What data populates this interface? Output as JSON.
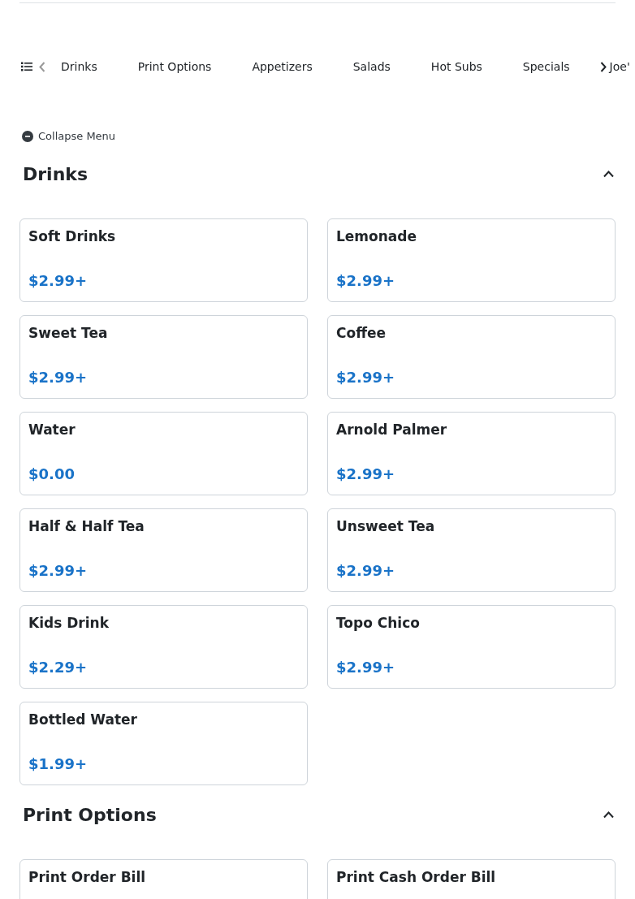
{
  "nav": {
    "tabs": [
      {
        "label": "Drinks",
        "selected": false
      },
      {
        "label": "Print Options",
        "selected": false
      },
      {
        "label": "Appetizers",
        "selected": false
      },
      {
        "label": "Salads",
        "selected": false
      },
      {
        "label": "Hot Subs",
        "selected": false
      },
      {
        "label": "Specials",
        "selected": false
      },
      {
        "label": "Joe'",
        "selected": false
      }
    ]
  },
  "collapse_menu": "Collapse Menu",
  "sections": [
    {
      "title": "Drinks",
      "expanded": true,
      "items": [
        {
          "name": "Soft Drinks",
          "price": "$2.99+"
        },
        {
          "name": "Lemonade",
          "price": "$2.99+"
        },
        {
          "name": "Sweet Tea",
          "price": "$2.99+"
        },
        {
          "name": "Coffee",
          "price": "$2.99+"
        },
        {
          "name": "Water",
          "price": "$0.00"
        },
        {
          "name": "Arnold Palmer",
          "price": "$2.99+"
        },
        {
          "name": "Half & Half Tea",
          "price": "$2.99+"
        },
        {
          "name": "Unsweet Tea",
          "price": "$2.99+"
        },
        {
          "name": "Kids Drink",
          "price": "$2.29+"
        },
        {
          "name": "Topo Chico",
          "price": "$2.99+"
        },
        {
          "name": "Bottled Water",
          "price": "$1.99+"
        }
      ]
    },
    {
      "title": "Print Options",
      "expanded": true,
      "items": [
        {
          "name": "Print Order Bill"
        },
        {
          "name": "Print Cash Order Bill"
        }
      ]
    }
  ]
}
